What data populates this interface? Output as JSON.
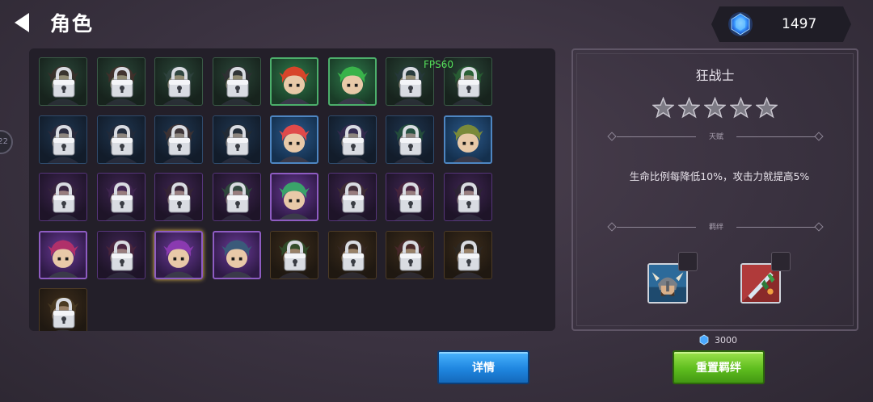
{
  "header": {
    "title": "角色"
  },
  "currency": {
    "value": "1497",
    "icon": "blue-gem-icon"
  },
  "side_badge": {
    "text": "22"
  },
  "fps": "FPS60",
  "heroes": [
    {
      "id": "h1",
      "theme": "green",
      "locked": true,
      "hair": "#4a2a2a"
    },
    {
      "id": "h2",
      "theme": "green",
      "locked": true,
      "hair": "#5a2b2b"
    },
    {
      "id": "h3",
      "theme": "green",
      "locked": true,
      "hair": "#3a4b4b"
    },
    {
      "id": "h4",
      "theme": "green",
      "locked": true,
      "hair": "#3a2a3a"
    },
    {
      "id": "h5",
      "theme": "green",
      "locked": false,
      "hair": "#d8452a"
    },
    {
      "id": "h6",
      "theme": "green",
      "locked": false,
      "hair": "#39b34a"
    },
    {
      "id": "h7",
      "theme": "green",
      "locked": true,
      "hair": "#2a3a46"
    },
    {
      "id": "h8",
      "theme": "green",
      "locked": true,
      "hair": "#2f7a3a"
    },
    {
      "id": "h9",
      "theme": "blue",
      "locked": true,
      "hair": "#3a2a3a"
    },
    {
      "id": "h10",
      "theme": "blue",
      "locked": true,
      "hair": "#2a2a35"
    },
    {
      "id": "h11",
      "theme": "blue",
      "locked": true,
      "hair": "#5a3a2a"
    },
    {
      "id": "h12",
      "theme": "blue",
      "locked": true,
      "hair": "#2a2a2a"
    },
    {
      "id": "h13",
      "theme": "blue",
      "locked": false,
      "hair": "#e04a4a"
    },
    {
      "id": "h14",
      "theme": "blue",
      "locked": true,
      "hair": "#4a2a5a"
    },
    {
      "id": "h15",
      "theme": "blue",
      "locked": true,
      "hair": "#2f6a3a"
    },
    {
      "id": "h16",
      "theme": "blue",
      "locked": false,
      "hair": "#7a8a3a"
    },
    {
      "id": "h17",
      "theme": "purple",
      "locked": true,
      "hair": "#3a2a3a"
    },
    {
      "id": "h18",
      "theme": "purple",
      "locked": true,
      "hair": "#4a2a5a"
    },
    {
      "id": "h19",
      "theme": "purple",
      "locked": true,
      "hair": "#3a2a2a"
    },
    {
      "id": "h20",
      "theme": "purple",
      "locked": true,
      "hair": "#2f6a3a"
    },
    {
      "id": "h21",
      "theme": "purple",
      "locked": false,
      "hair": "#3aa36a"
    },
    {
      "id": "h22",
      "theme": "purple",
      "locked": true,
      "hair": "#4a3a2a"
    },
    {
      "id": "h23",
      "theme": "purple",
      "locked": true,
      "hair": "#5a2a3a"
    },
    {
      "id": "h24",
      "theme": "purple",
      "locked": true,
      "hair": "#2a2a2a"
    },
    {
      "id": "h25",
      "theme": "purple",
      "locked": false,
      "hair": "#b0306a"
    },
    {
      "id": "h26",
      "theme": "purple",
      "locked": true,
      "hair": "#5a2a3a"
    },
    {
      "id": "h27",
      "theme": "purple",
      "locked": false,
      "hair": "#8a3ab0",
      "selected": true
    },
    {
      "id": "h28",
      "theme": "purple",
      "locked": false,
      "hair": "#3a5a7a"
    },
    {
      "id": "h29",
      "theme": "orange",
      "locked": true,
      "hair": "#2f6a3a"
    },
    {
      "id": "h30",
      "theme": "orange",
      "locked": true,
      "hair": "#3a2a2a"
    },
    {
      "id": "h31",
      "theme": "orange",
      "locked": true,
      "hair": "#5a2a3a"
    },
    {
      "id": "h32",
      "theme": "orange",
      "locked": true,
      "hair": "#2a2a2a"
    },
    {
      "id": "h33",
      "theme": "orange",
      "locked": true,
      "hair": "#5a4a2a"
    }
  ],
  "detail": {
    "name": "狂战士",
    "stars": 5,
    "talent_label": "天赋",
    "talent_text": "生命比例每降低10%，攻击力就提高5%",
    "bond_label": "羁绊",
    "bonds": [
      {
        "icon": "viking-warrior-portrait-icon"
      },
      {
        "icon": "red-fire-weapon-icon"
      }
    ]
  },
  "reset_cost": "3000",
  "buttons": {
    "detail": "详情",
    "reset_bond": "重置羁绊"
  },
  "colors": {
    "accent_gold": "#f2c94c",
    "blue_button": "#1f86e0",
    "green_button": "#5ebd1e"
  }
}
